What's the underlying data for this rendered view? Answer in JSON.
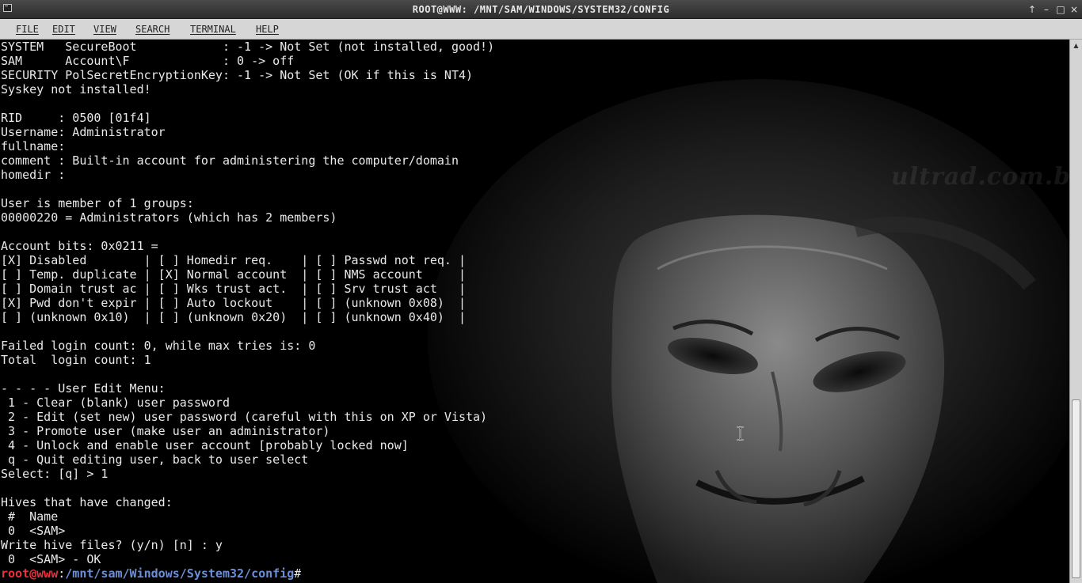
{
  "window": {
    "title": "root@www: /mnt/sam/Windows/System32/config",
    "icon": "terminal-icon",
    "controls": {
      "up": "↑",
      "minimize": "–",
      "maximize": "□",
      "close": "×"
    }
  },
  "menubar": {
    "items": [
      "File",
      "Edit",
      "View",
      "Search",
      "Terminal",
      "Help"
    ]
  },
  "terminal": {
    "lines": [
      "SYSTEM   SecureBoot            : -1 -> Not Set (not installed, good!)",
      "SAM      Account\\F             : 0 -> off",
      "SECURITY PolSecretEncryptionKey: -1 -> Not Set (OK if this is NT4)",
      "Syskey not installed!",
      "",
      "RID     : 0500 [01f4]",
      "Username: Administrator",
      "fullname:",
      "comment : Built-in account for administering the computer/domain",
      "homedir :",
      "",
      "User is member of 1 groups:",
      "00000220 = Administrators (which has 2 members)",
      "",
      "Account bits: 0x0211 =",
      "[X] Disabled        | [ ] Homedir req.    | [ ] Passwd not req. |",
      "[ ] Temp. duplicate | [X] Normal account  | [ ] NMS account     |",
      "[ ] Domain trust ac | [ ] Wks trust act.  | [ ] Srv trust act   |",
      "[X] Pwd don't expir | [ ] Auto lockout    | [ ] (unknown 0x08)  |",
      "[ ] (unknown 0x10)  | [ ] (unknown 0x20)  | [ ] (unknown 0x40)  |",
      "",
      "Failed login count: 0, while max tries is: 0",
      "Total  login count: 1",
      "",
      "- - - - User Edit Menu:",
      " 1 - Clear (blank) user password",
      " 2 - Edit (set new) user password (careful with this on XP or Vista)",
      " 3 - Promote user (make user an administrator)",
      " 4 - Unlock and enable user account [probably locked now]",
      " q - Quit editing user, back to user select",
      "Select: [q] > 1",
      "",
      "Hives that have changed:",
      " #  Name",
      " 0  <SAM>",
      "Write hive files? (y/n) [n] : y",
      " 0  <SAM> - OK"
    ],
    "prompt": {
      "user_host": "root@www",
      "separator": ":",
      "path": "/mnt/sam/Windows/System32/config",
      "symbol": "#"
    }
  },
  "background": {
    "watermark": "ultrad.com.br"
  },
  "colors": {
    "terminal_bg": "#000000",
    "terminal_fg": "#e9e9e9",
    "prompt_user": "#e8333a",
    "prompt_path": "#6b8fd6",
    "titlebar_bg": "#3a3a3a",
    "menubar_bg": "#d6d6d6"
  }
}
